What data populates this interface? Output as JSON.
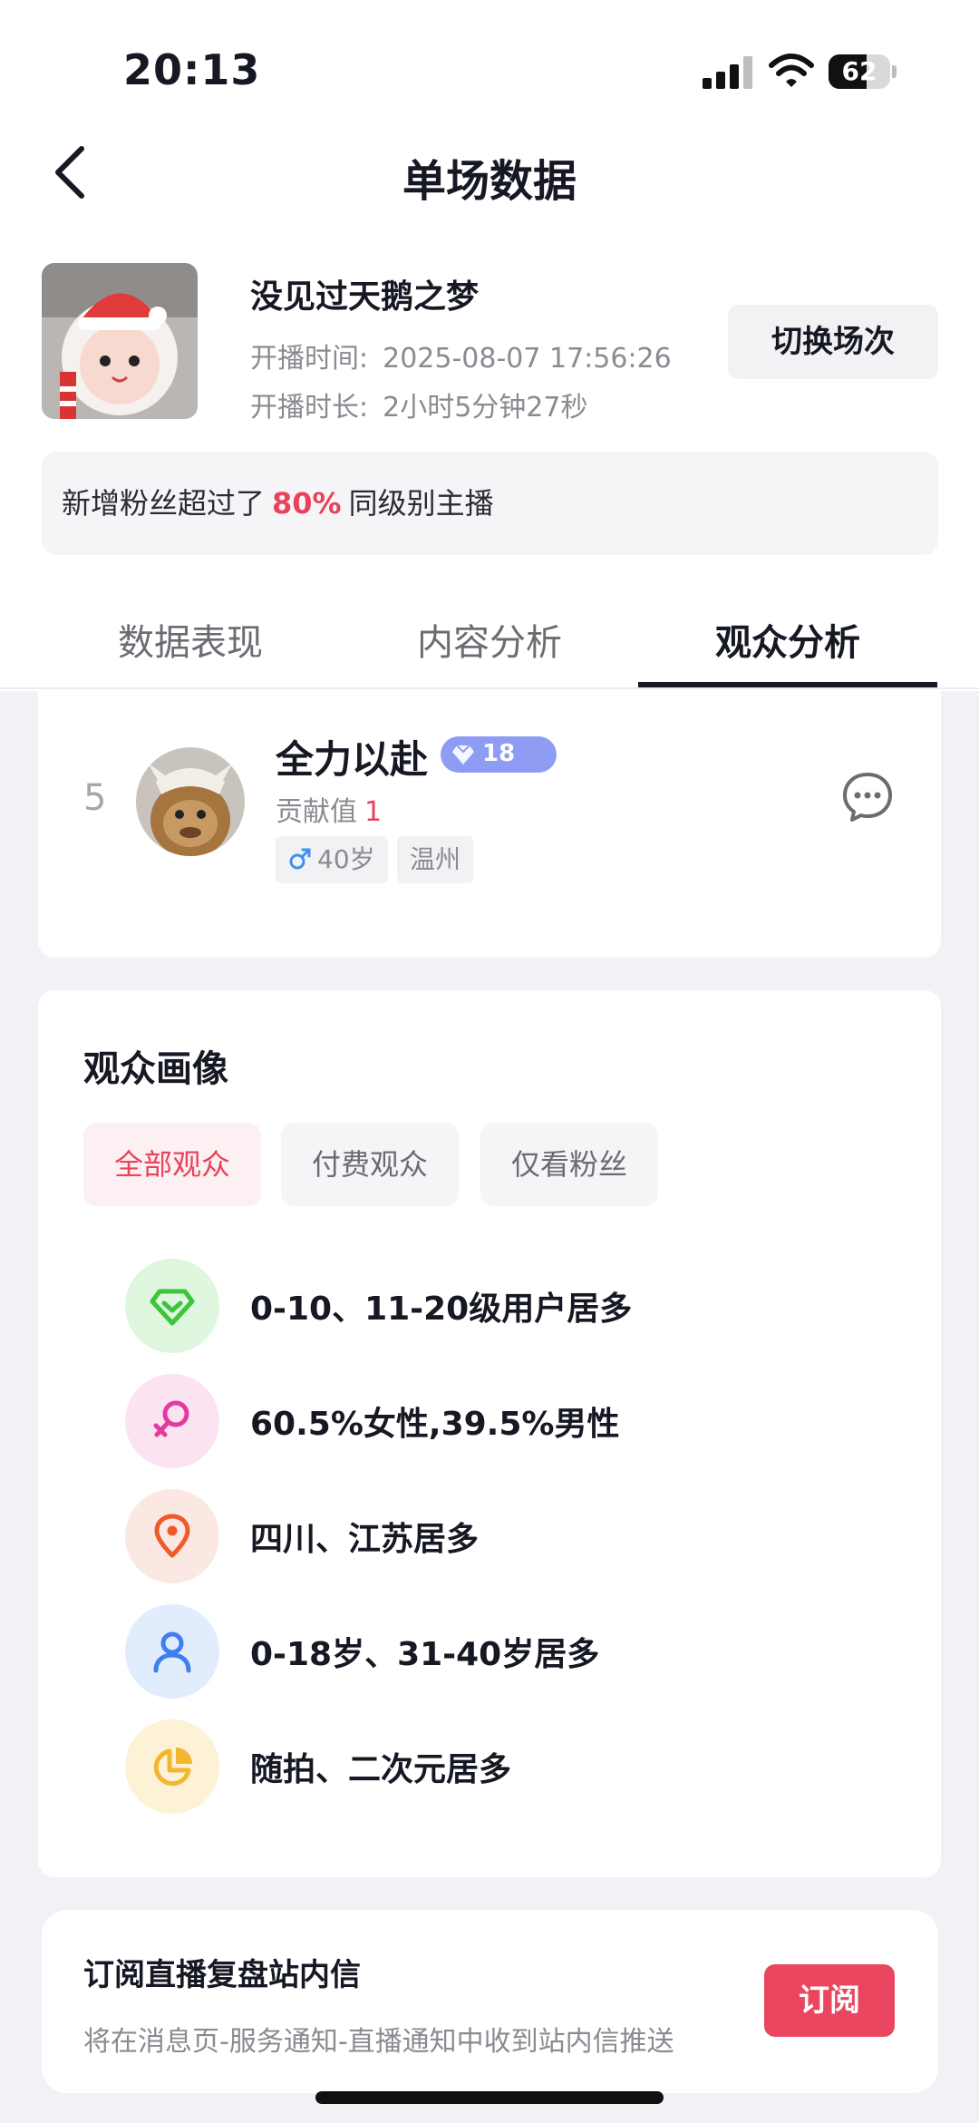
{
  "status_bar": {
    "time": "20:13",
    "battery_level": "62",
    "battery_fraction": 0.62
  },
  "nav": {
    "title": "单场数据"
  },
  "session": {
    "streamer_name": "没见过天鹅之梦",
    "start_label": "开播时间:",
    "start_value": "2025-08-07 17:56:26",
    "duration_label": "开播时长:",
    "duration_value": "2小时5分钟27秒",
    "switch_label": "切换场次"
  },
  "compare": {
    "prefix": "新增粉丝超过了",
    "percent": "80%",
    "suffix": "同级别主播"
  },
  "tabs": [
    {
      "label": "数据表现"
    },
    {
      "label": "内容分析"
    },
    {
      "label": "观众分析"
    }
  ],
  "viewer": {
    "rank": "5",
    "name": "全力以赴",
    "level": "18",
    "contribution_label": "贡献值",
    "contribution_value": "1",
    "age": "40岁",
    "city": "温州"
  },
  "portrait": {
    "title": "观众画像",
    "filters": [
      {
        "label": "全部观众"
      },
      {
        "label": "付费观众"
      },
      {
        "label": "仅看粉丝"
      }
    ],
    "traits": [
      {
        "icon": "diamond-level-icon",
        "text": "0-10、11-20级用户居多",
        "bg": "#dff6df",
        "color": "#3cc43c"
      },
      {
        "icon": "female-gender-icon",
        "text": "60.5%女性,39.5%男性",
        "bg": "#fbe3f1",
        "color": "#e43aa0"
      },
      {
        "icon": "location-pin-icon",
        "text": "四川、江苏居多",
        "bg": "#fbe8e2",
        "color": "#f05a2a"
      },
      {
        "icon": "person-age-icon",
        "text": "0-18岁、31-40岁居多",
        "bg": "#e1ecfd",
        "color": "#3f7ef0"
      },
      {
        "icon": "pie-chart-icon",
        "text": "随拍、二次元居多",
        "bg": "#fdf1d6",
        "color": "#f2b731"
      }
    ]
  },
  "subscribe": {
    "title": "订阅直播复盘站内信",
    "description": "将在消息页-服务通知-直播通知中收到站内信推送",
    "button": "订阅"
  },
  "colors": {
    "accent": "#e9435c",
    "badge": "#8f9cf4",
    "page_bg": "#f1f2f6"
  }
}
